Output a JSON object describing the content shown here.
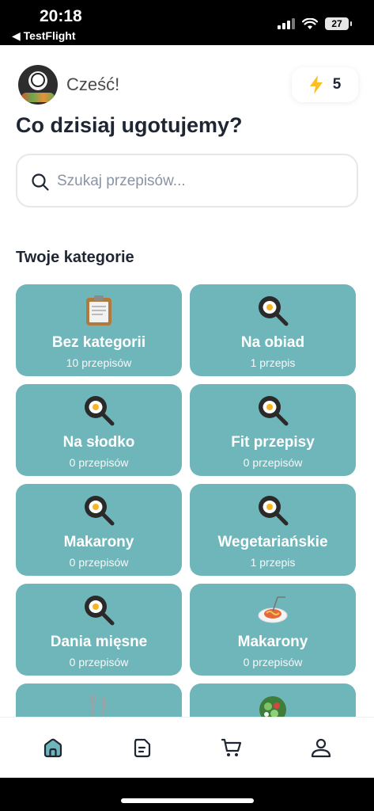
{
  "status": {
    "time": "20:18",
    "back_label": "◀ TestFlight",
    "battery": "27"
  },
  "header": {
    "greeting": "Cześć!",
    "energy_count": "5",
    "title": "Co dzisiaj ugotujemy?"
  },
  "search": {
    "placeholder": "Szukaj przepisów..."
  },
  "categories_title": "Twoje kategorie",
  "categories": [
    {
      "name": "Bez kategorii",
      "count": "10 przepisów",
      "icon": "clipboard-icon"
    },
    {
      "name": "Na obiad",
      "count": "1 przepis",
      "icon": "frying-pan-icon"
    },
    {
      "name": "Na słodko",
      "count": "0 przepisów",
      "icon": "frying-pan-icon"
    },
    {
      "name": "Fit przepisy",
      "count": "0 przepisów",
      "icon": "frying-pan-icon"
    },
    {
      "name": "Makarony",
      "count": "0 przepisów",
      "icon": "frying-pan-icon"
    },
    {
      "name": "Wegetariańskie",
      "count": "1 przepis",
      "icon": "frying-pan-icon"
    },
    {
      "name": "Dania mięsne",
      "count": "0 przepisów",
      "icon": "frying-pan-icon"
    },
    {
      "name": "Makarony",
      "count": "0 przepisów",
      "icon": "spaghetti-icon"
    },
    {
      "name": "",
      "count": "",
      "icon": "fork-knife-icon"
    },
    {
      "name": "",
      "count": "",
      "icon": "salad-icon"
    }
  ],
  "nav": [
    "home-icon",
    "recipes-icon",
    "cart-icon",
    "profile-icon"
  ],
  "colors": {
    "card": "#6fb6bb",
    "accent": "#fbbf24",
    "text": "#1f2633"
  }
}
